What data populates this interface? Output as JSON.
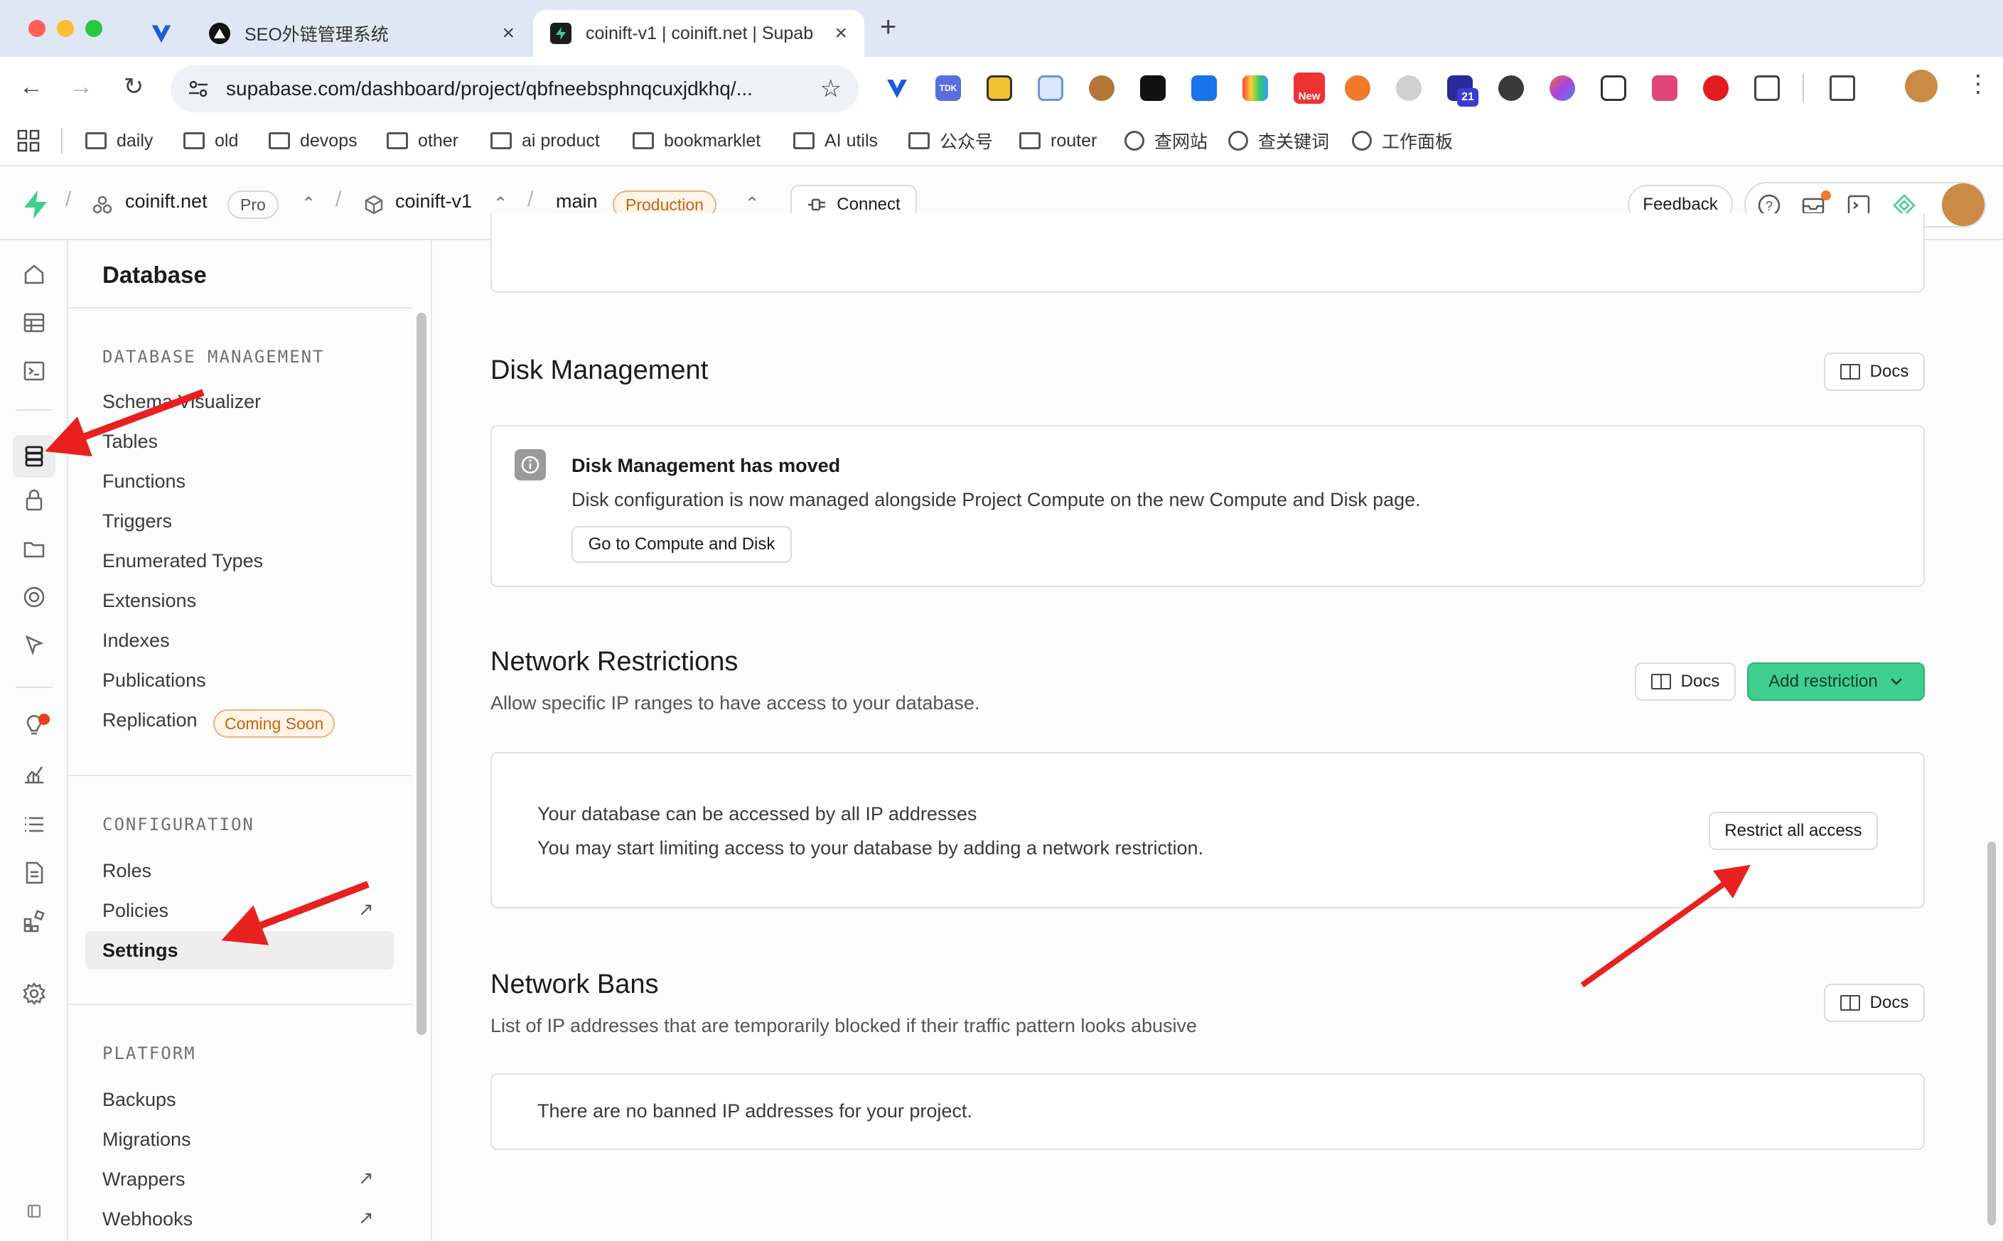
{
  "browser": {
    "tabs": [
      {
        "label": "",
        "favicon": "v-logo-icon"
      },
      {
        "label": "SEO外链管理系统",
        "favicon": "triangle-logo-icon"
      },
      {
        "label": "coinift-v1 | coinift.net | Supab",
        "favicon": "supabase-icon"
      }
    ],
    "url": "supabase.com/dashboard/project/qbfneebsphnqcuxjdkhq/...",
    "ext_badges": {
      "new": "New",
      "count": "21",
      "tdk": "TDK"
    },
    "bookmarks": [
      {
        "label": "daily",
        "type": "folder"
      },
      {
        "label": "old",
        "type": "folder"
      },
      {
        "label": "devops",
        "type": "folder"
      },
      {
        "label": "other",
        "type": "folder"
      },
      {
        "label": "ai product",
        "type": "folder"
      },
      {
        "label": "bookmarklet",
        "type": "folder"
      },
      {
        "label": "AI utils",
        "type": "folder"
      },
      {
        "label": "公众号",
        "type": "folder"
      },
      {
        "label": "router",
        "type": "folder"
      },
      {
        "label": "查网站",
        "type": "site"
      },
      {
        "label": "查关键词",
        "type": "site"
      },
      {
        "label": "工作面板",
        "type": "site"
      }
    ]
  },
  "header": {
    "org": "coinift.net",
    "plan": "Pro",
    "project": "coinift-v1",
    "branch": "main",
    "env": "Production",
    "connect": "Connect",
    "feedback": "Feedback"
  },
  "sidebar": {
    "title": "Database",
    "sections": {
      "management": "DATABASE MANAGEMENT",
      "configuration": "CONFIGURATION",
      "platform": "PLATFORM"
    },
    "management_items": [
      "Schema Visualizer",
      "Tables",
      "Functions",
      "Triggers",
      "Enumerated Types",
      "Extensions",
      "Indexes",
      "Publications",
      "Replication"
    ],
    "coming_soon": "Coming Soon",
    "config_items": [
      "Roles",
      "Policies",
      "Settings"
    ],
    "platform_items": [
      "Backups",
      "Migrations",
      "Wrappers",
      "Webhooks"
    ],
    "active_item": "Settings"
  },
  "main": {
    "disk": {
      "title": "Disk Management",
      "docs": "Docs",
      "notice_title": "Disk Management has moved",
      "notice_body": "Disk configuration is now managed alongside Project Compute on the new Compute and Disk page.",
      "button": "Go to Compute and Disk"
    },
    "network": {
      "title": "Network Restrictions",
      "subtitle": "Allow specific IP ranges to have access to your database.",
      "docs": "Docs",
      "add": "Add restriction",
      "line1": "Your database can be accessed by all IP addresses",
      "line2": "You may start limiting access to your database by adding a network restriction.",
      "restrict": "Restrict all access"
    },
    "bans": {
      "title": "Network Bans",
      "subtitle": "List of IP addresses that are temporarily blocked if their traffic pattern looks abusive",
      "docs": "Docs",
      "empty": "There are no banned IP addresses for your project."
    }
  },
  "colors": {
    "accent": "#3ecf8e",
    "accent_border": "#2fb07a",
    "warning": "#c8640c",
    "arrow": "#e8201f"
  }
}
